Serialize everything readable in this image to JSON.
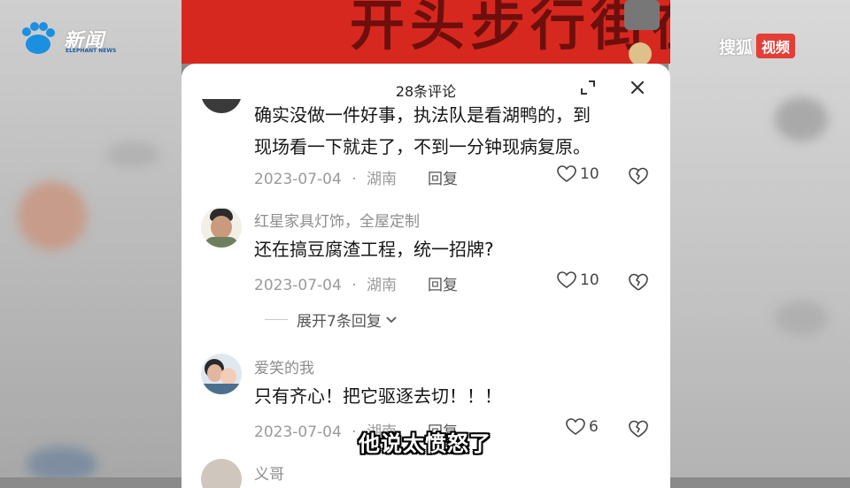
{
  "logos": {
    "left_cn": "新闻",
    "left_en": "ELEPHANT NEWS",
    "right_brand": "搜狐",
    "right_badge": "视频"
  },
  "background": {
    "headline": "开头步行街在西"
  },
  "sheet": {
    "title": "28条评论"
  },
  "comments": [
    {
      "user": "",
      "lines": [
        "确实没做一件好事，执法队是看湖鸭的，到",
        "现场看一下就走了，不到一分钟现病复原。"
      ],
      "date": "2023-07-04",
      "sep": "·",
      "location": "湖南",
      "reply_label": "回复",
      "likes": "10"
    },
    {
      "user": "红星家具灯饰，全屋定制",
      "lines": [
        "还在搞豆腐渣工程，统一招牌?"
      ],
      "date": "2023-07-04",
      "sep": "·",
      "location": "湖南",
      "reply_label": "回复",
      "likes": "10",
      "expand_label": "展开7条回复"
    },
    {
      "user": "爱笑的我",
      "lines": [
        "只有齐心！把它驱逐去切！！！"
      ],
      "date": "2023-07-04",
      "sep": "·",
      "location": "湖南",
      "reply_label": "回复",
      "likes": "6"
    },
    {
      "user": "义哥"
    }
  ],
  "subtitle": "他说太愤怒了",
  "colors": {
    "accent_red": "#e33f37",
    "brand_blue": "#1b8fe0"
  }
}
